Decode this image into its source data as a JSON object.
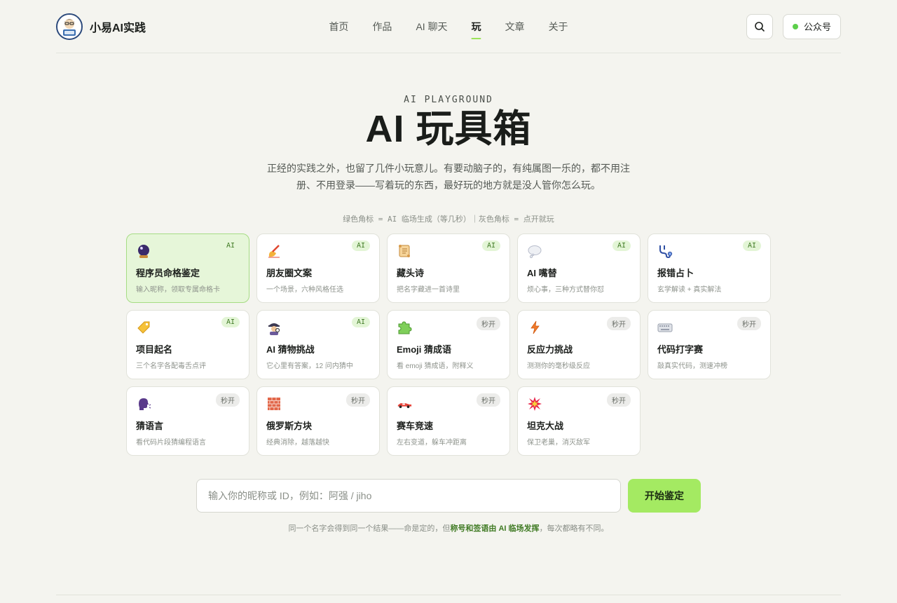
{
  "header": {
    "brand_name": "小易AI实践",
    "nav": [
      {
        "label": "首页",
        "active": false
      },
      {
        "label": "作品",
        "active": false
      },
      {
        "label": "AI 聊天",
        "active": false
      },
      {
        "label": "玩",
        "active": true
      },
      {
        "label": "文章",
        "active": false
      },
      {
        "label": "关于",
        "active": false
      }
    ],
    "search_icon": "search-icon",
    "wechat_label": "公众号",
    "status_dot_color": "#5ccf4b"
  },
  "hero": {
    "eyebrow": "AI PLAYGROUND",
    "title": "AI 玩具箱",
    "subtitle": "正经的实践之外，也留了几件小玩意儿。有要动脑子的，有纯属图一乐的，都不用注册、不用登录——写着玩的东西，最好玩的地方就是没人管你怎么玩。",
    "legend": "绿色角标 = AI 临场生成（等几秒）｜灰色角标 = 点开就玩"
  },
  "tags": {
    "ai": "AI",
    "instant": "秒开"
  },
  "cards": [
    {
      "name": "程序员命格鉴定",
      "desc": "输入昵称，领取专属命格卡",
      "tag": "ai",
      "icon": "crystal-ball-icon",
      "active": true
    },
    {
      "name": "朋友圈文案",
      "desc": "一个场景，六种风格任选",
      "tag": "ai",
      "icon": "writing-hand-icon",
      "active": false
    },
    {
      "name": "藏头诗",
      "desc": "把名字藏进一首诗里",
      "tag": "ai",
      "icon": "scroll-icon",
      "active": false
    },
    {
      "name": "AI 嘴替",
      "desc": "烦心事，三种方式替你怼",
      "tag": "ai",
      "icon": "speech-bubble-icon",
      "active": false
    },
    {
      "name": "报错占卜",
      "desc": "玄学解读 + 真实解法",
      "tag": "ai",
      "icon": "stethoscope-icon",
      "active": false
    },
    {
      "name": "项目起名",
      "desc": "三个名字各配毒舌点评",
      "tag": "ai",
      "icon": "label-tag-icon",
      "active": false
    },
    {
      "name": "AI 猜物挑战",
      "desc": "它心里有答案，12 问内猜中",
      "tag": "ai",
      "icon": "detective-icon",
      "active": false
    },
    {
      "name": "Emoji 猜成语",
      "desc": "看 emoji 猜成语，附释义",
      "tag": "instant",
      "icon": "puzzle-icon",
      "active": false
    },
    {
      "name": "反应力挑战",
      "desc": "测测你的毫秒级反应",
      "tag": "instant",
      "icon": "lightning-icon",
      "active": false
    },
    {
      "name": "代码打字赛",
      "desc": "敲真实代码，测速冲榜",
      "tag": "instant",
      "icon": "keyboard-icon",
      "active": false
    },
    {
      "name": "猜语言",
      "desc": "看代码片段猜编程语言",
      "tag": "instant",
      "icon": "speaking-head-icon",
      "active": false
    },
    {
      "name": "俄罗斯方块",
      "desc": "经典消除，越落越快",
      "tag": "instant",
      "icon": "brick-icon",
      "active": false
    },
    {
      "name": "赛车竞速",
      "desc": "左右变道，躲车冲距离",
      "tag": "instant",
      "icon": "race-car-icon",
      "active": false
    },
    {
      "name": "坦克大战",
      "desc": "保卫老巢，消灭敌军",
      "tag": "instant",
      "icon": "explosion-icon",
      "active": false
    }
  ],
  "form": {
    "placeholder": "输入你的昵称或 ID，例如：阿强 / jiho",
    "value": "",
    "submit_label": "开始鉴定",
    "note_before": "同一个名字会得到同一个结果——命是定的，但",
    "note_highlight": "称号和签语由 AI 临场发挥",
    "note_after": "，每次都略有不同。"
  },
  "colors": {
    "accent": "#a4ea62",
    "active_card_bg": "#e6f6d9",
    "ai_tag_text": "#3f7a23"
  }
}
